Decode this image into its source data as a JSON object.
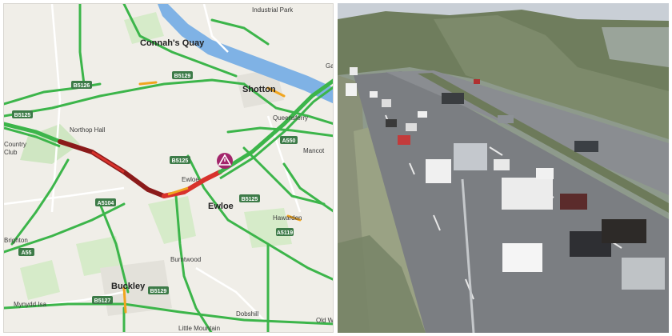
{
  "map": {
    "places": {
      "industrial_park": "Industrial Park",
      "connahs_quay": "Connah's Quay",
      "shotton": "Shotton",
      "northop_hall": "Northop Hall",
      "queensferry": "Queensferry",
      "mancot": "Mancot",
      "ewloe_small": "Ewloe",
      "ewloe": "Ewloe",
      "country_club": "Country\nClub",
      "hawarden": "Hawarden",
      "brighton": "Brighton",
      "burntwood": "Burntwood",
      "buckley": "Buckley",
      "mynydd_isa": "Mynydd Isa",
      "little_mountain": "Little Mountain",
      "old_w": "Old W",
      "ga": "Ga",
      "dobshill": "Dobshill",
      "a5": "A5"
    },
    "roads": {
      "b5129_a": "B5129",
      "b5129_b": "B5129",
      "b5126": "B5126",
      "b5125_a": "B5125",
      "b5125_b": "B5125",
      "b5125_c": "B5125",
      "a550": "A550",
      "a5104": "A5104",
      "a55": "A55",
      "a5119": "A5119",
      "b5127": "B5127"
    },
    "incident_icon": "warning-triangle-icon",
    "traffic_colors": {
      "free": "#3cb54a",
      "slow": "#f1a51e",
      "heavy": "#d8322c",
      "stopped": "#8b1a1a"
    }
  },
  "camera": {
    "scene": "motorway traffic camera"
  }
}
